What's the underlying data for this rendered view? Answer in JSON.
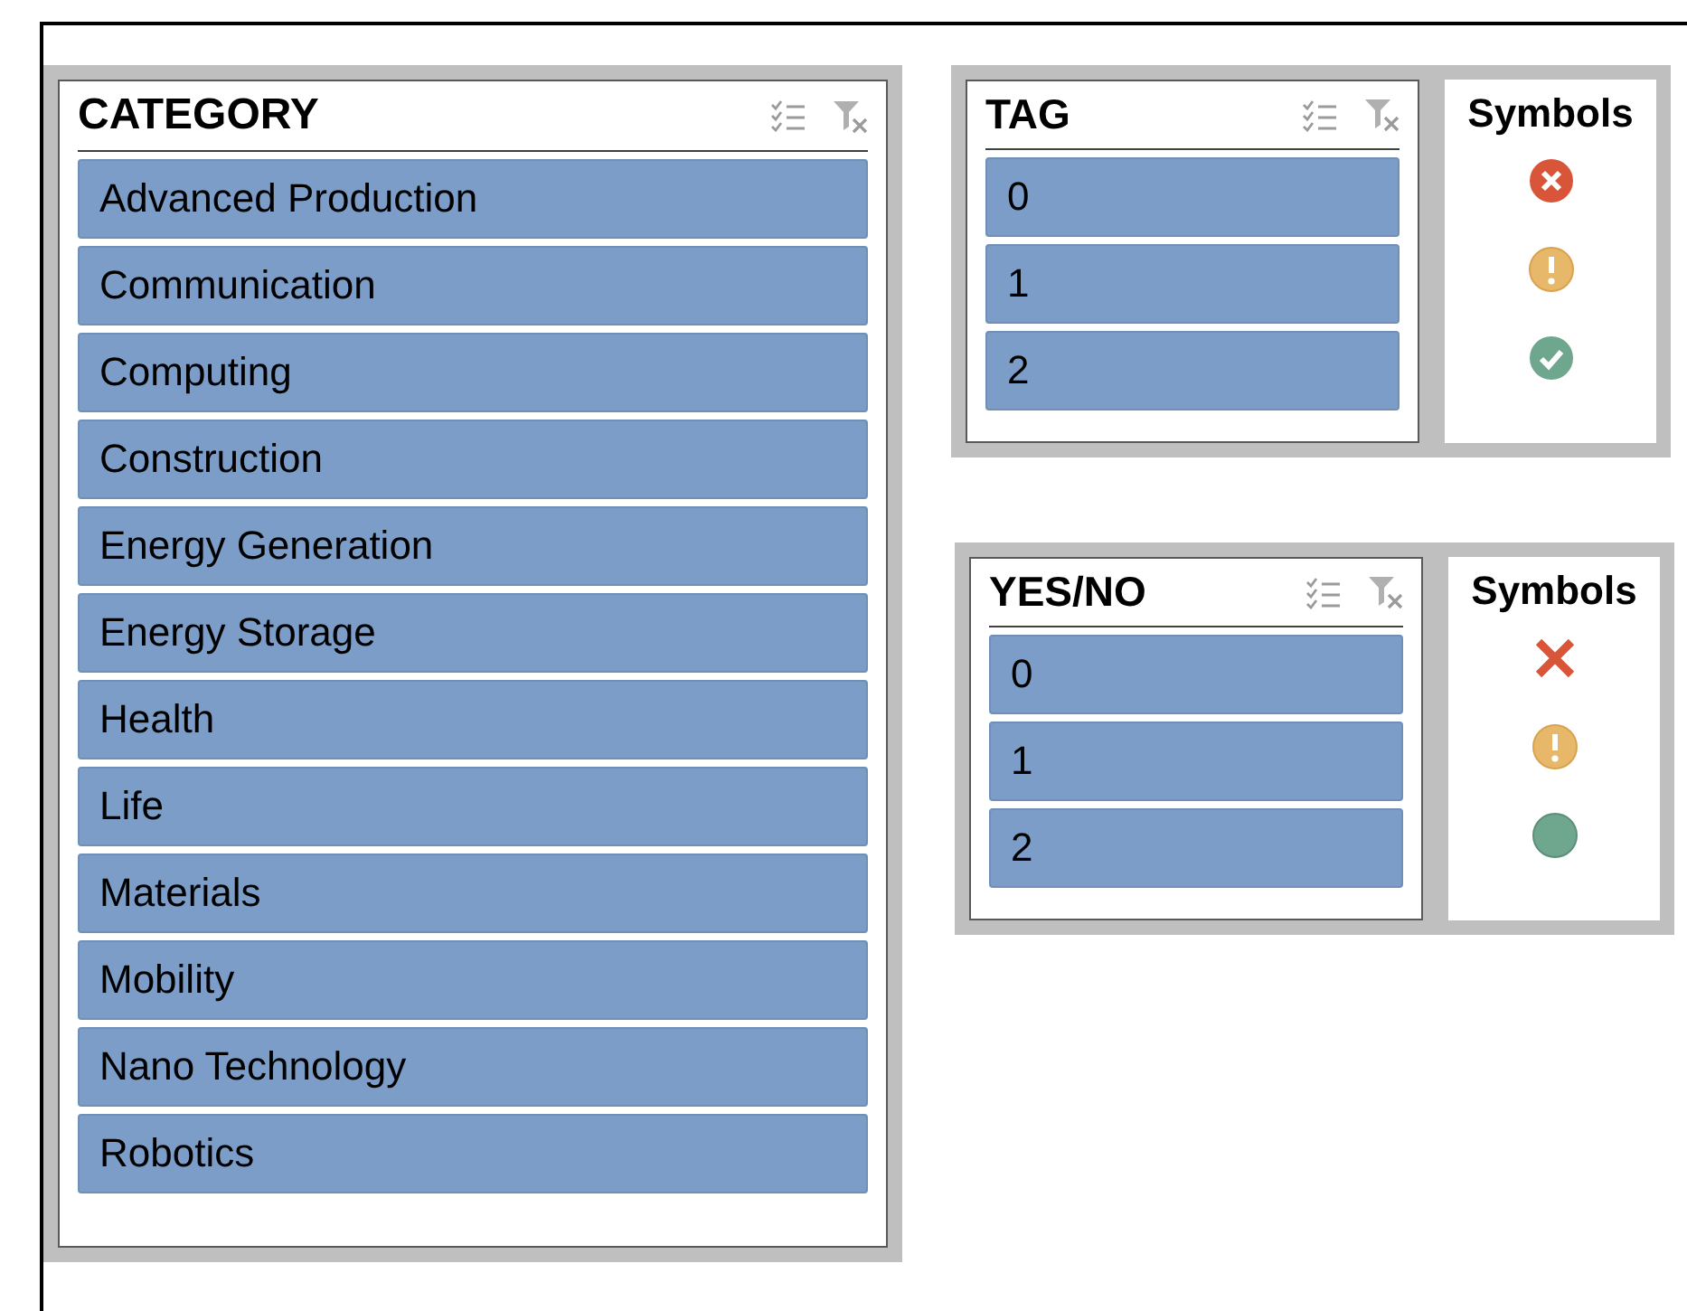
{
  "category": {
    "title": "CATEGORY",
    "items": [
      {
        "label": "Advanced Production",
        "selected": true
      },
      {
        "label": "Communication",
        "selected": true
      },
      {
        "label": "Computing",
        "selected": true
      },
      {
        "label": "Construction",
        "selected": true
      },
      {
        "label": "Energy Generation",
        "selected": true
      },
      {
        "label": "Energy Storage",
        "selected": true
      },
      {
        "label": "Health",
        "selected": true
      },
      {
        "label": "Life",
        "selected": true
      },
      {
        "label": "Materials",
        "selected": true
      },
      {
        "label": "Mobility",
        "selected": true
      },
      {
        "label": "Nano Technology",
        "selected": true
      },
      {
        "label": "Robotics",
        "selected": true
      }
    ]
  },
  "groups": [
    {
      "slicer": {
        "title": "TAG",
        "items": [
          {
            "label": "0",
            "selected": true
          },
          {
            "label": "1",
            "selected": true
          },
          {
            "label": "2",
            "selected": true
          }
        ]
      },
      "symbols": {
        "title": "Symbols",
        "icons": [
          {
            "kind": "cross-circle",
            "color": "#d9553a"
          },
          {
            "kind": "exclamation-circle",
            "color": "#e8b86a"
          },
          {
            "kind": "check-circle",
            "color": "#6ea68e"
          }
        ]
      }
    },
    {
      "slicer": {
        "title": "YES/NO",
        "items": [
          {
            "label": "0",
            "selected": true
          },
          {
            "label": "1",
            "selected": true
          },
          {
            "label": "2",
            "selected": true
          }
        ]
      },
      "symbols": {
        "title": "Symbols",
        "icons": [
          {
            "kind": "cross",
            "color": "#d9553a"
          },
          {
            "kind": "exclamation-circle",
            "color": "#e8b86a"
          },
          {
            "kind": "circle",
            "color": "#6ea68e"
          }
        ]
      }
    }
  ]
}
